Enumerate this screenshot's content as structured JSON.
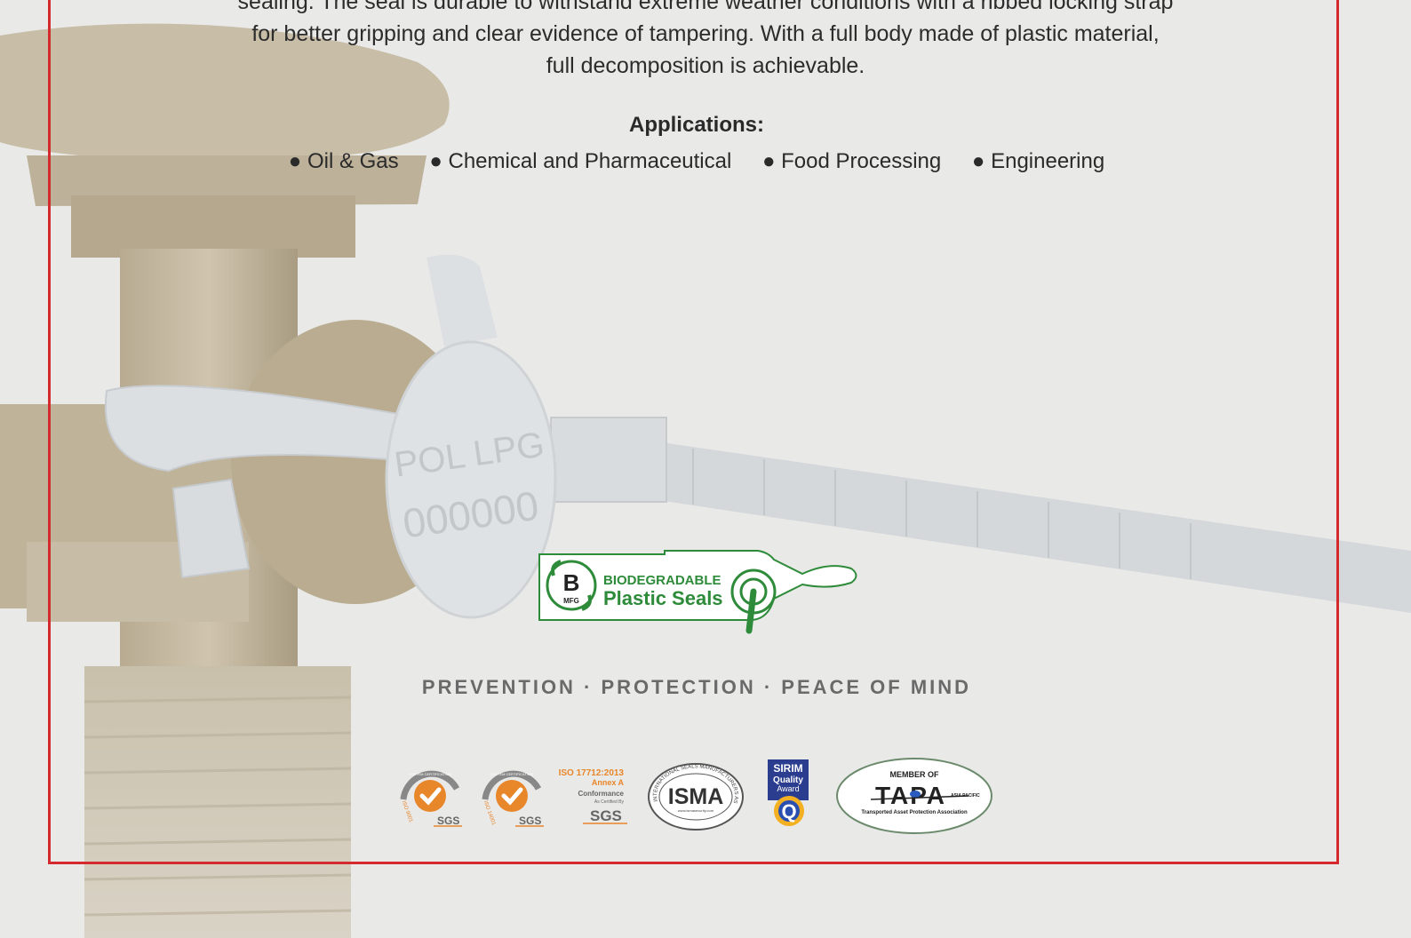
{
  "description": {
    "line1": "sealing. The seal is durable to withstand extreme weather conditions with a ribbed locking strap",
    "line2": "for better gripping and clear evidence of tampering. With a full body made of plastic material,",
    "line3": "full decomposition is achievable."
  },
  "applications": {
    "title": "Applications:",
    "items": [
      "● Oil & Gas",
      "● Chemical and Pharmaceutical",
      "● Food Processing",
      "● Engineering"
    ]
  },
  "photo": {
    "seal_text_1": "POL LPG",
    "seal_text_2": "000000"
  },
  "logo": {
    "letter": "B",
    "mfg": "MFG",
    "line1": "BIODEGRADABLE",
    "line2": "Plastic Seals"
  },
  "tagline": "PREVENTION · PROTECTION · PEACE OF MIND",
  "certifications": {
    "sgs1": {
      "top": "SYSTEM CERTIFICATION",
      "side": "ISO 9001",
      "brand": "SGS"
    },
    "sgs2": {
      "top": "SYSTEM CERTIFICATION",
      "side": "ISO 14001",
      "brand": "SGS"
    },
    "iso": {
      "line1": "ISO 17712:2013",
      "line2": "Annex A",
      "line3": "Conformance",
      "line4": "As Certified By",
      "brand": "SGS"
    },
    "isma": {
      "name": "ISMA",
      "ring": "INTERNATIONAL SEALS MANUFACTURERS ASSOCIATION",
      "url": "www.ismasecurity.com"
    },
    "sirim": {
      "line1": "SIRIM",
      "line2": "Quality",
      "line3": "Award",
      "letter": "Q"
    },
    "tapa": {
      "member": "MEMBER OF",
      "name": "TAPA",
      "region": "ASIA PACIFIC",
      "full": "Transported Asset Protection Association"
    }
  },
  "colors": {
    "frame": "#d42a2e",
    "green": "#2e8b3a",
    "orange": "#e8862a",
    "text": "#2a2a2a"
  }
}
